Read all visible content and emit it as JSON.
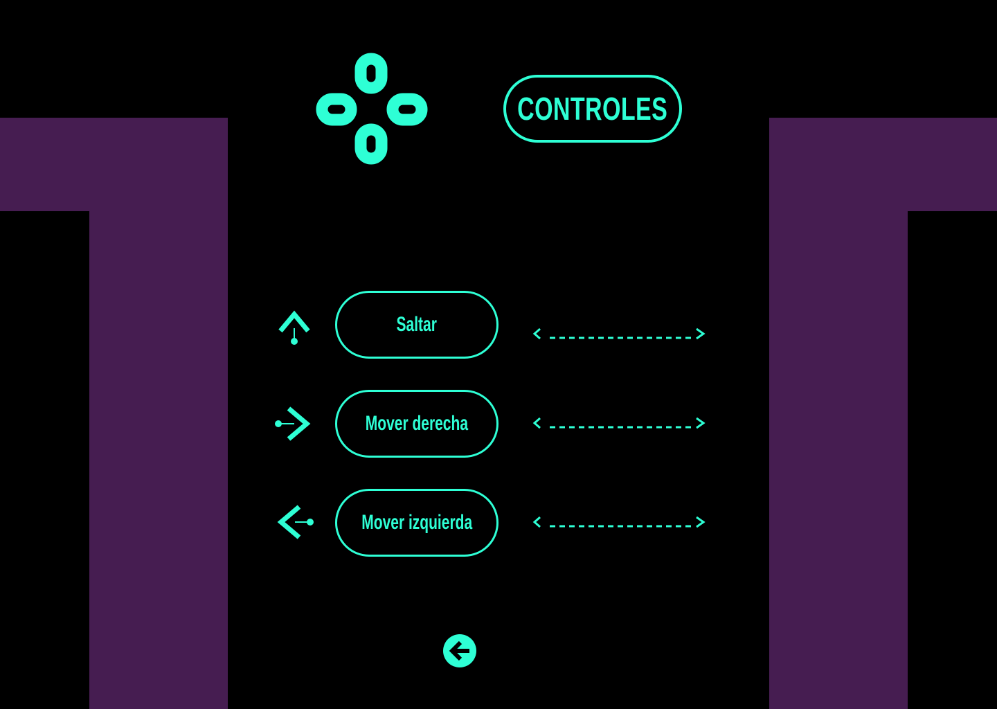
{
  "colors": {
    "background": "#000000",
    "accent": "#2EFFD5",
    "decoration": "#461D51"
  },
  "header": {
    "title": "CONTROLES",
    "icon": "gamepad-dpad-icon"
  },
  "controls": [
    {
      "label": "Saltar",
      "icon": "arrow-up-icon",
      "key": ""
    },
    {
      "label": "Mover derecha",
      "icon": "arrow-right-icon",
      "key": ""
    },
    {
      "label": "Mover izquierda",
      "icon": "arrow-left-icon",
      "key": ""
    }
  ],
  "footer": {
    "back_icon": "back-arrow-circle-icon"
  }
}
